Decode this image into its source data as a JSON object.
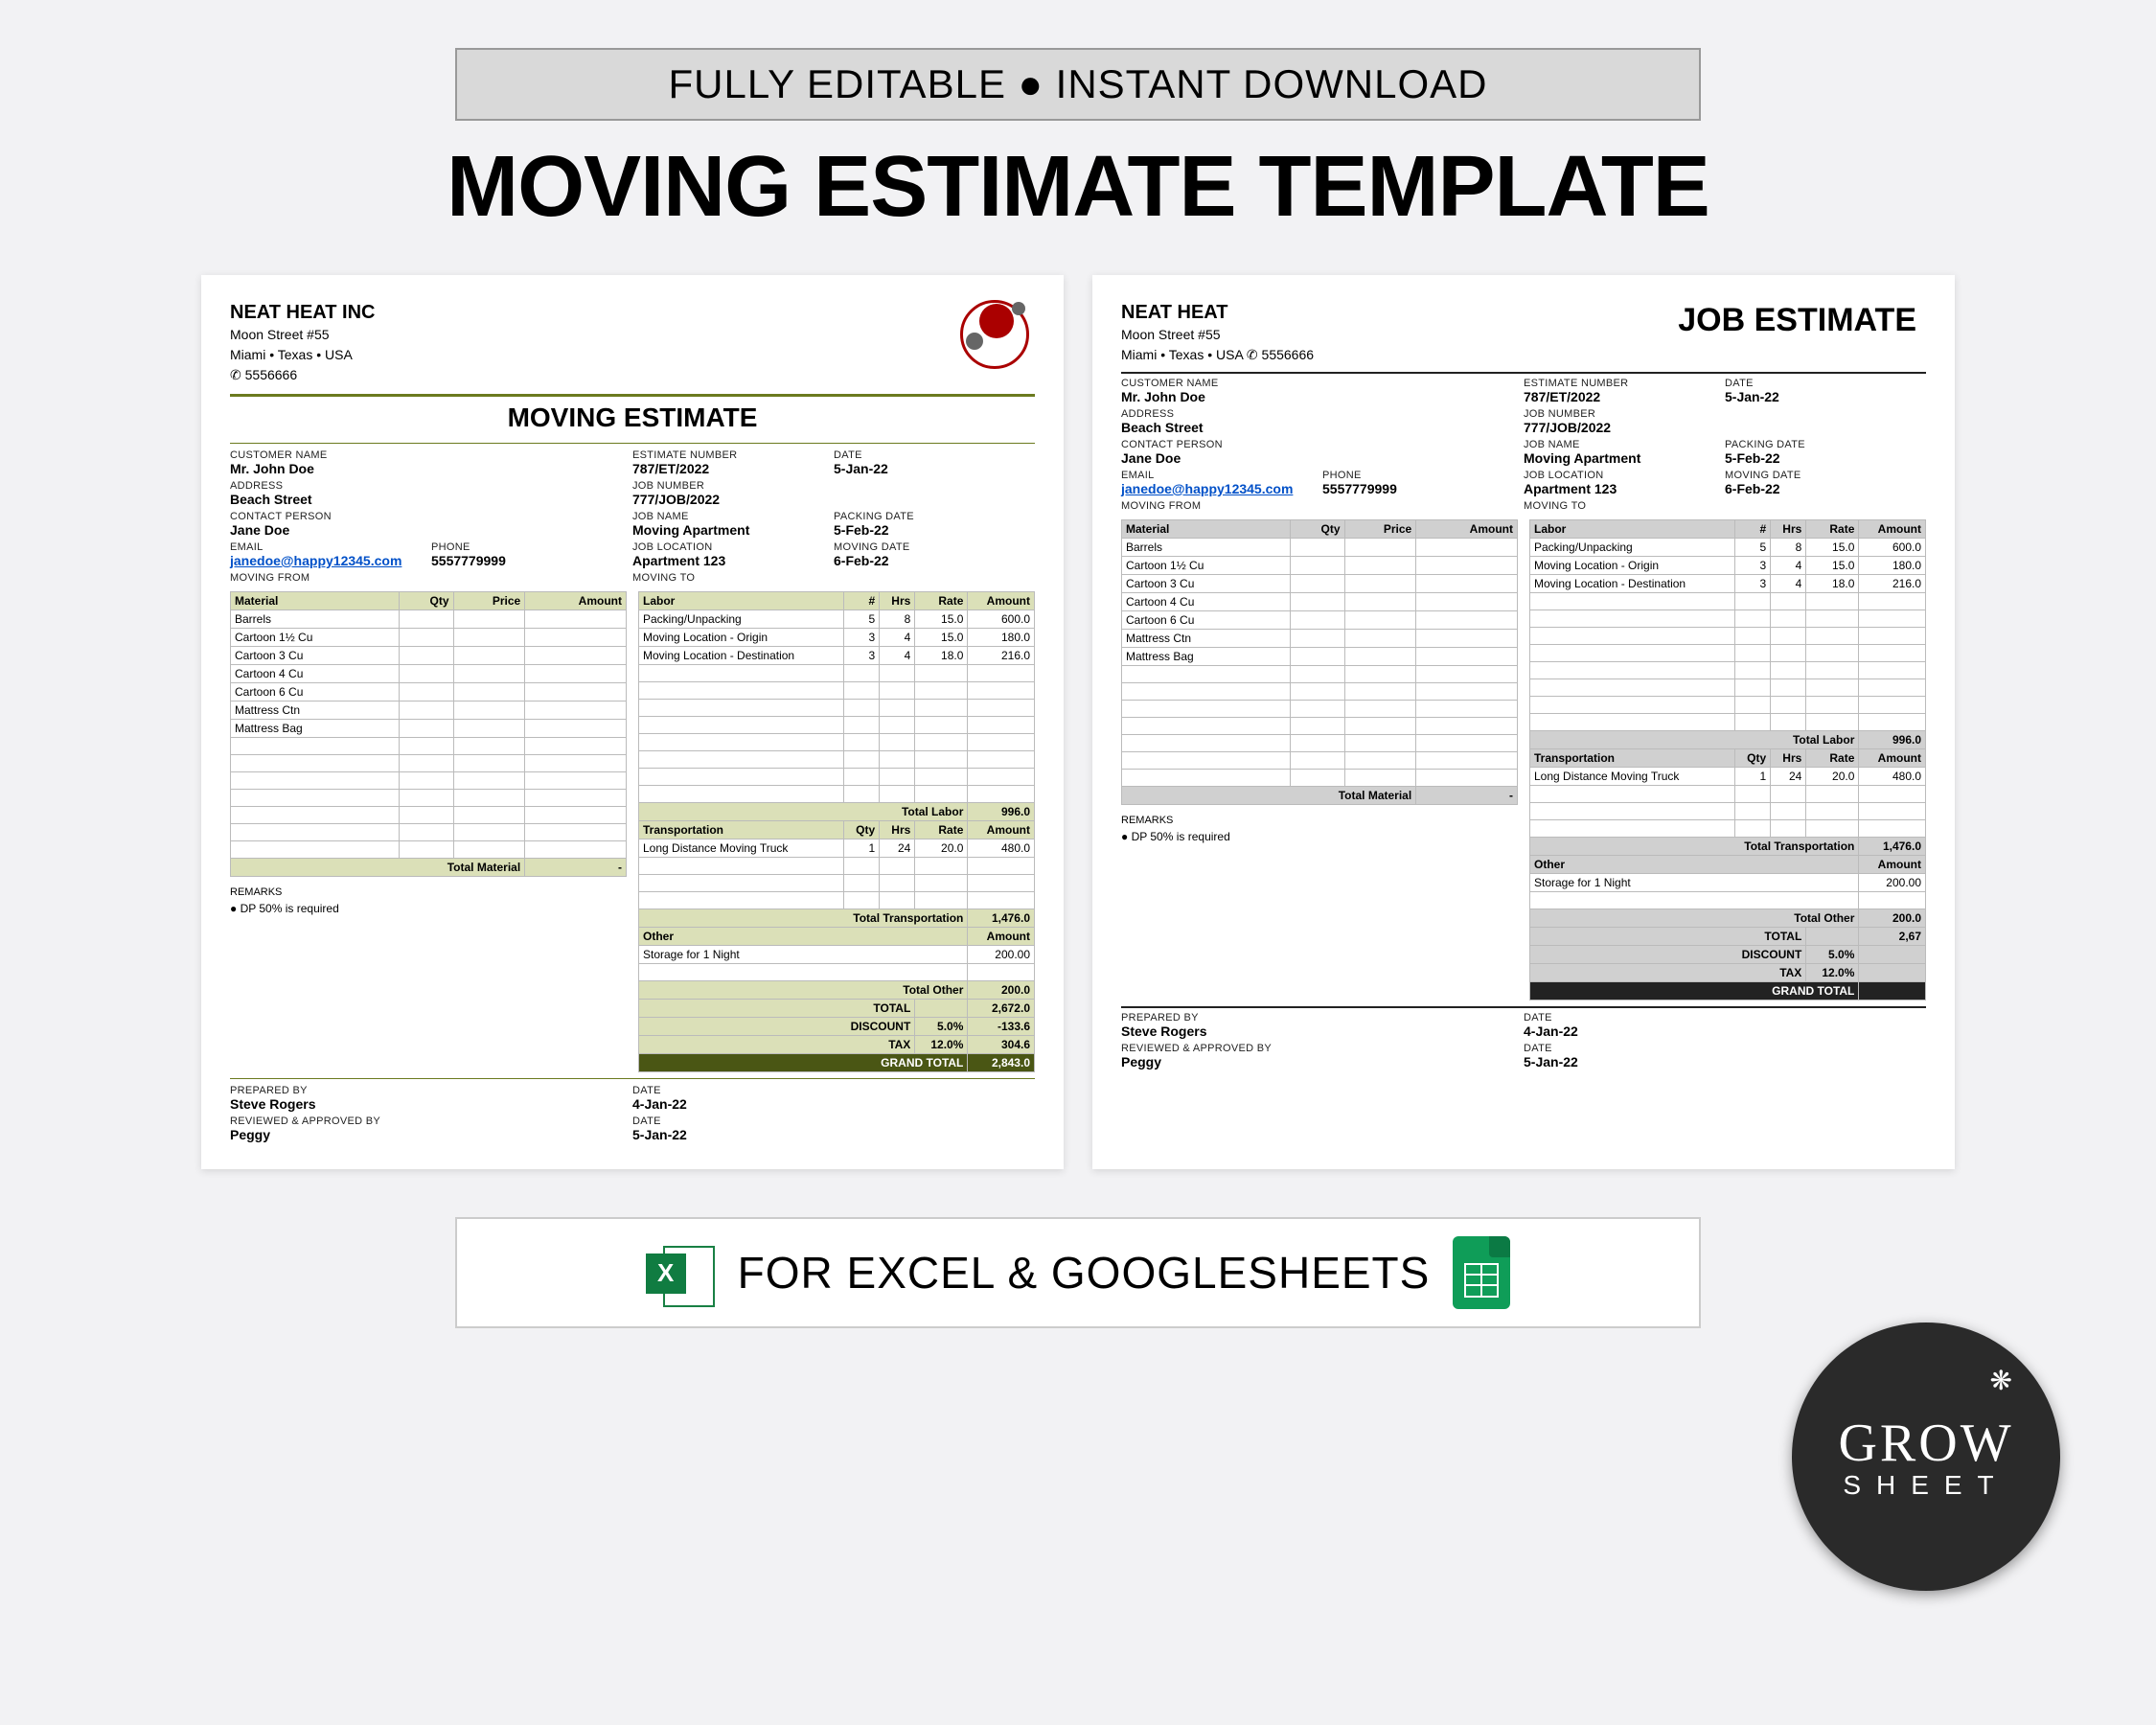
{
  "banner": "FULLY EDITABLE ● INSTANT DOWNLOAD",
  "title": "MOVING ESTIMATE TEMPLATE",
  "footer": "FOR EXCEL & GOOGLESHEETS",
  "badge": {
    "line1": "GROW",
    "line2": "SHEET"
  },
  "sheet1": {
    "company": "NEAT HEAT INC",
    "addr1": "Moon Street #55",
    "addr2": "Miami • Texas • USA",
    "phone": "✆ 5556666",
    "docTitle": "MOVING ESTIMATE",
    "fields": {
      "customerName": "Mr. John Doe",
      "estimateNumber": "787/ET/2022",
      "date": "5-Jan-22",
      "address": "Beach Street",
      "jobNumber": "777/JOB/2022",
      "contactPerson": "Jane Doe",
      "jobName": "Moving Apartment",
      "packingDate": "5-Feb-22",
      "email": "janedoe@happy12345.com",
      "phoneVal": "5557779999",
      "jobLocation": "Apartment 123",
      "movingDate": "6-Feb-22"
    },
    "materials": [
      "Barrels",
      "Cartoon 1½ Cu",
      "Cartoon 3 Cu",
      "Cartoon 4 Cu",
      "Cartoon 6 Cu",
      "Mattress Ctn",
      "Mattress Bag"
    ],
    "labor": [
      {
        "name": "Packing/Unpacking",
        "n": "5",
        "hrs": "8",
        "rate": "15.0",
        "amt": "600.0"
      },
      {
        "name": "Moving Location - Origin",
        "n": "3",
        "hrs": "4",
        "rate": "15.0",
        "amt": "180.0"
      },
      {
        "name": "Moving Location - Destination",
        "n": "3",
        "hrs": "4",
        "rate": "18.0",
        "amt": "216.0"
      }
    ],
    "totalLabor": "996.0",
    "transport": [
      {
        "name": "Long Distance Moving Truck",
        "qty": "1",
        "hrs": "24",
        "rate": "20.0",
        "amt": "480.0"
      }
    ],
    "totalTransport": "1,476.0",
    "other": [
      {
        "name": "Storage for 1 Night",
        "amt": "200.00"
      }
    ],
    "totalOther": "200.0",
    "remarks": "● DP 50% is required",
    "preparedBy": "Steve Rogers",
    "preparedDate": "4-Jan-22",
    "reviewedBy": "Peggy",
    "reviewedDate": "5-Jan-22",
    "totals": {
      "total": "2,672.0",
      "discountPct": "5.0%",
      "discount": "-133.6",
      "taxPct": "12.0%",
      "tax": "304.6",
      "grand": "2,843.0"
    }
  },
  "sheet2": {
    "company": "NEAT HEAT",
    "addr1": "Moon Street #55",
    "addr2": "Miami • Texas • USA ✆ 5556666",
    "docTitle": "JOB ESTIMATE",
    "fields": {
      "customerName": "Mr. John Doe",
      "estimateNumber": "787/ET/2022",
      "date": "5-Jan-22",
      "address": "Beach Street",
      "jobNumber": "777/JOB/2022",
      "contactPerson": "Jane Doe",
      "jobName": "Moving Apartment",
      "packingDate": "5-Feb-22",
      "email": "janedoe@happy12345.com",
      "phoneVal": "5557779999",
      "jobLocation": "Apartment 123",
      "movingDate": "6-Feb-22"
    },
    "materials": [
      "Barrels",
      "Cartoon 1½ Cu",
      "Cartoon 3 Cu",
      "Cartoon 4 Cu",
      "Cartoon 6 Cu",
      "Mattress Ctn",
      "Mattress Bag"
    ],
    "labor": [
      {
        "name": "Packing/Unpacking",
        "n": "5",
        "hrs": "8",
        "rate": "15.0",
        "amt": "600.0"
      },
      {
        "name": "Moving Location - Origin",
        "n": "3",
        "hrs": "4",
        "rate": "15.0",
        "amt": "180.0"
      },
      {
        "name": "Moving Location - Destination",
        "n": "3",
        "hrs": "4",
        "rate": "18.0",
        "amt": "216.0"
      }
    ],
    "totalLabor": "996.0",
    "transport": [
      {
        "name": "Long Distance Moving Truck",
        "qty": "1",
        "hrs": "24",
        "rate": "20.0",
        "amt": "480.0"
      }
    ],
    "totalTransport": "1,476.0",
    "other": [
      {
        "name": "Storage for 1 Night",
        "amt": "200.00"
      }
    ],
    "totalOther": "200.0",
    "remarks": "● DP 50% is required",
    "preparedBy": "Steve Rogers",
    "preparedDate": "4-Jan-22",
    "reviewedBy": "Peggy",
    "reviewedDate": "5-Jan-22",
    "totals": {
      "total": "2,67",
      "discountPct": "5.0%",
      "taxPct": "12.0%"
    }
  },
  "labels": {
    "customerName": "CUSTOMER NAME",
    "estimateNumber": "ESTIMATE NUMBER",
    "date": "DATE",
    "address": "ADDRESS",
    "jobNumber": "JOB NUMBER",
    "contactPerson": "CONTACT PERSON",
    "jobName": "JOB NAME",
    "packingDate": "PACKING DATE",
    "email": "EMAIL",
    "phone": "PHONE",
    "jobLocation": "JOB LOCATION",
    "movingDate": "MOVING DATE",
    "movingFrom": "MOVING FROM",
    "movingTo": "MOVING TO",
    "material": "Material",
    "qty": "Qty",
    "price": "Price",
    "amount": "Amount",
    "labor": "Labor",
    "hash": "#",
    "hrs": "Hrs",
    "rate": "Rate",
    "totalLabor": "Total Labor",
    "transportation": "Transportation",
    "totalTransport": "Total Transportation",
    "other": "Other",
    "totalOther": "Total Other",
    "totalMaterial": "Total Material",
    "remarks": "REMARKS",
    "preparedBy": "PREPARED BY",
    "reviewedBy": "REVIEWED & APPROVED BY",
    "total": "TOTAL",
    "discount": "DISCOUNT",
    "tax": "TAX",
    "grandTotal": "GRAND TOTAL"
  }
}
